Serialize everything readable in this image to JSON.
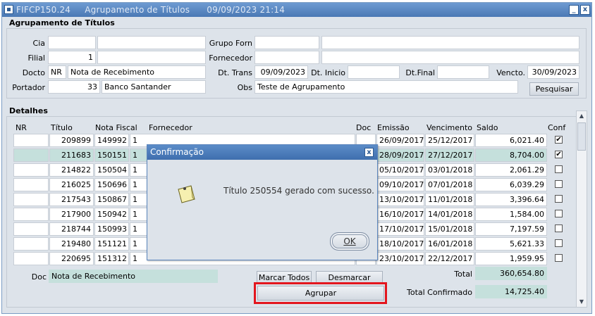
{
  "window": {
    "title": "FIFCP150.24     Agrupamento de Títulos      09/09/2023 21:14",
    "minimize": "_",
    "close": "x"
  },
  "agrupamento": {
    "section_title": "Agrupamento de Títulos",
    "cia_label": "Cia",
    "cia_value": "",
    "cia_name": "",
    "filial_label": "Filial",
    "filial_value": "1",
    "filial_name": "",
    "grupo_forn_label": "Grupo Forn",
    "grupo_forn_value": "",
    "grupo_forn_name": "",
    "fornecedor_label": "Fornecedor",
    "fornecedor_value": "",
    "fornecedor_name": "",
    "docto_label": "Docto",
    "docto_code": "NR",
    "docto_name": "Nota de Recebimento",
    "dt_trans_label": "Dt. Trans",
    "dt_trans_value": "09/09/2023",
    "dt_inicio_label": "Dt. Inicio",
    "dt_inicio_value": "",
    "dt_final_label": "Dt.Final",
    "dt_final_value": "",
    "vencto_label": "Vencto.",
    "vencto_value": "30/09/2023",
    "portador_label": "Portador",
    "portador_code": "33",
    "portador_name": "Banco Santander",
    "obs_label": "Obs",
    "obs_value": "Teste de Agrupamento",
    "pesquisar_button": "Pesquisar"
  },
  "detalhes": {
    "section_title": "Detalhes",
    "columns": {
      "nr": "NR",
      "titulo": "Título",
      "nota_fiscal": "Nota Fiscal",
      "fornecedor": "Fornecedor",
      "doc": "Doc",
      "emissao": "Emissão",
      "vencimento": "Vencimento",
      "saldo": "Saldo",
      "conf": "Conf"
    },
    "rows": [
      {
        "nr": "",
        "titulo": "209899",
        "nota": "149992",
        "forn": "1",
        "emissao": "26/09/2017",
        "vencimento": "25/12/2017",
        "saldo": "6,021.40",
        "conf": true
      },
      {
        "nr": "",
        "titulo": "211683",
        "nota": "150151",
        "forn": "1",
        "emissao": "28/09/2017",
        "vencimento": "27/12/2017",
        "saldo": "8,704.00",
        "conf": true
      },
      {
        "nr": "",
        "titulo": "214822",
        "nota": "150504",
        "forn": "1",
        "emissao": "05/10/2017",
        "vencimento": "03/01/2018",
        "saldo": "2,061.29",
        "conf": false
      },
      {
        "nr": "",
        "titulo": "216025",
        "nota": "150696",
        "forn": "1",
        "emissao": "09/10/2017",
        "vencimento": "07/01/2018",
        "saldo": "6,039.29",
        "conf": false
      },
      {
        "nr": "",
        "titulo": "217543",
        "nota": "150867",
        "forn": "1",
        "emissao": "13/10/2017",
        "vencimento": "11/01/2018",
        "saldo": "3,396.64",
        "conf": false
      },
      {
        "nr": "",
        "titulo": "217900",
        "nota": "150942",
        "forn": "1",
        "emissao": "16/10/2017",
        "vencimento": "14/01/2018",
        "saldo": "1,584.00",
        "conf": false
      },
      {
        "nr": "",
        "titulo": "218744",
        "nota": "150993",
        "forn": "1",
        "emissao": "17/10/2017",
        "vencimento": "15/01/2018",
        "saldo": "7,197.59",
        "conf": false
      },
      {
        "nr": "",
        "titulo": "219480",
        "nota": "151121",
        "forn": "1",
        "emissao": "18/10/2017",
        "vencimento": "16/01/2018",
        "saldo": "5,621.33",
        "conf": false
      },
      {
        "nr": "",
        "titulo": "220695",
        "nota": "151312",
        "forn": "1",
        "emissao": "23/10/2017",
        "vencimento": "22/12/2017",
        "saldo": "1,959.95",
        "conf": false
      }
    ],
    "doc_label": "Doc",
    "doc_value": "Nota de Recebimento",
    "marcar_todos": "Marcar Todos",
    "desmarcar_todos": "Desmarcar todos",
    "agrupar": "Agrupar",
    "total_label": "Total",
    "total_value": "360,654.80",
    "total_confirmado_label": "Total Confirmado",
    "total_confirmado_value": "14,725.40"
  },
  "dialog": {
    "title": "Confirmação",
    "close": "x",
    "message": "Título 250554 gerado com sucesso.",
    "ok_button": "OK"
  },
  "colors": {
    "titlebar": "#4a78b4",
    "selected_row": "#c5e0dc",
    "highlight": "#e3161e"
  }
}
